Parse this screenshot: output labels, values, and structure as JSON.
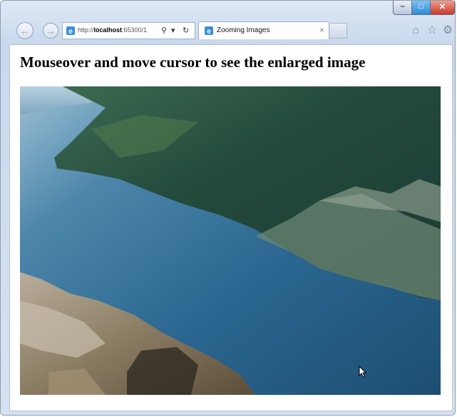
{
  "browser": {
    "address": {
      "protocol": "http://",
      "host": "localhost",
      "rest": ":65300/1"
    },
    "tab": {
      "title": "Zooming Images",
      "close": "×"
    },
    "search_icon": "search-icon",
    "dropdown": "▾",
    "refresh": "↻",
    "window_controls": {
      "minimize": "–",
      "maximize": "□",
      "close": "✕"
    },
    "nav": {
      "back": "←",
      "forward": "→"
    },
    "tools": {
      "home": "⌂",
      "favorites": "☆",
      "settings": "⚙"
    }
  },
  "page": {
    "heading": "Mouseover and move cursor to see the enlarged image",
    "image_alt": "fjord landscape photo"
  },
  "colors": {
    "accent": "#2f8ad4",
    "close": "#c7382a"
  }
}
